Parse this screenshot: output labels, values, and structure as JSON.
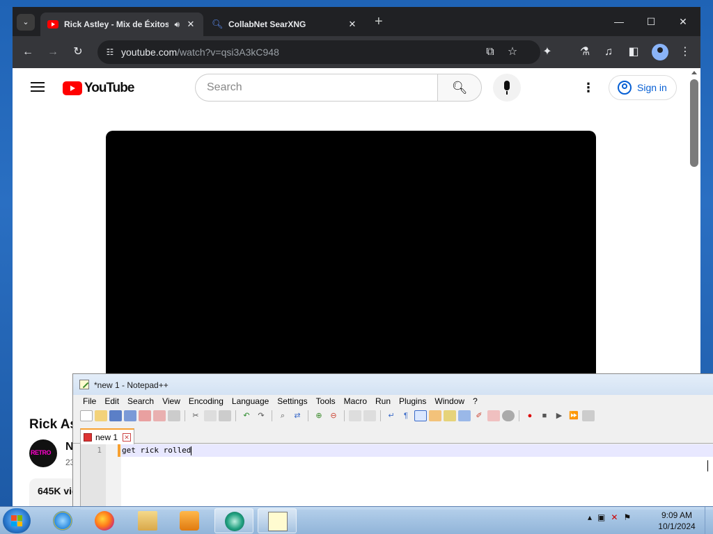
{
  "browser": {
    "tabs": [
      {
        "title": "Rick Astley - Mix de Éxitos",
        "icon": "youtube-icon",
        "audio": "speaker-icon"
      },
      {
        "title": "CollabNet SearXNG",
        "icon": "search-icon"
      }
    ],
    "url_domain": "youtube.com",
    "url_path": "/watch?v=qsi3A3kC948",
    "new_tab_symbol": "+"
  },
  "youtube": {
    "logo_text": "YouTube",
    "search_placeholder": "Search",
    "sign_in_label": "Sign in",
    "video_title_visible": "Rick As",
    "channel_name_visible": "N",
    "channel_sub_visible": "23",
    "channel_avatar_text": "RETRO",
    "views_visible": "645K vie"
  },
  "notepadpp": {
    "window_title": "*new 1 - Notepad++",
    "menu": [
      "File",
      "Edit",
      "Search",
      "View",
      "Encoding",
      "Language",
      "Settings",
      "Tools",
      "Macro",
      "Run",
      "Plugins",
      "Window",
      "?"
    ],
    "tab_label": "new 1",
    "line_number": "1",
    "line_text": "get rick rolled"
  },
  "taskbar": {
    "time": "9:09 AM",
    "date": "10/1/2024",
    "pinned": [
      "internet-explorer-icon",
      "firefox-icon",
      "file-explorer-icon",
      "media-player-icon",
      "app-icon",
      "notepadpp-icon"
    ]
  },
  "colors": {
    "chrome_dark": "#202124",
    "youtube_red": "#ff0000",
    "signin_blue": "#065fd4",
    "npp_tab_accent": "#f7a030"
  }
}
